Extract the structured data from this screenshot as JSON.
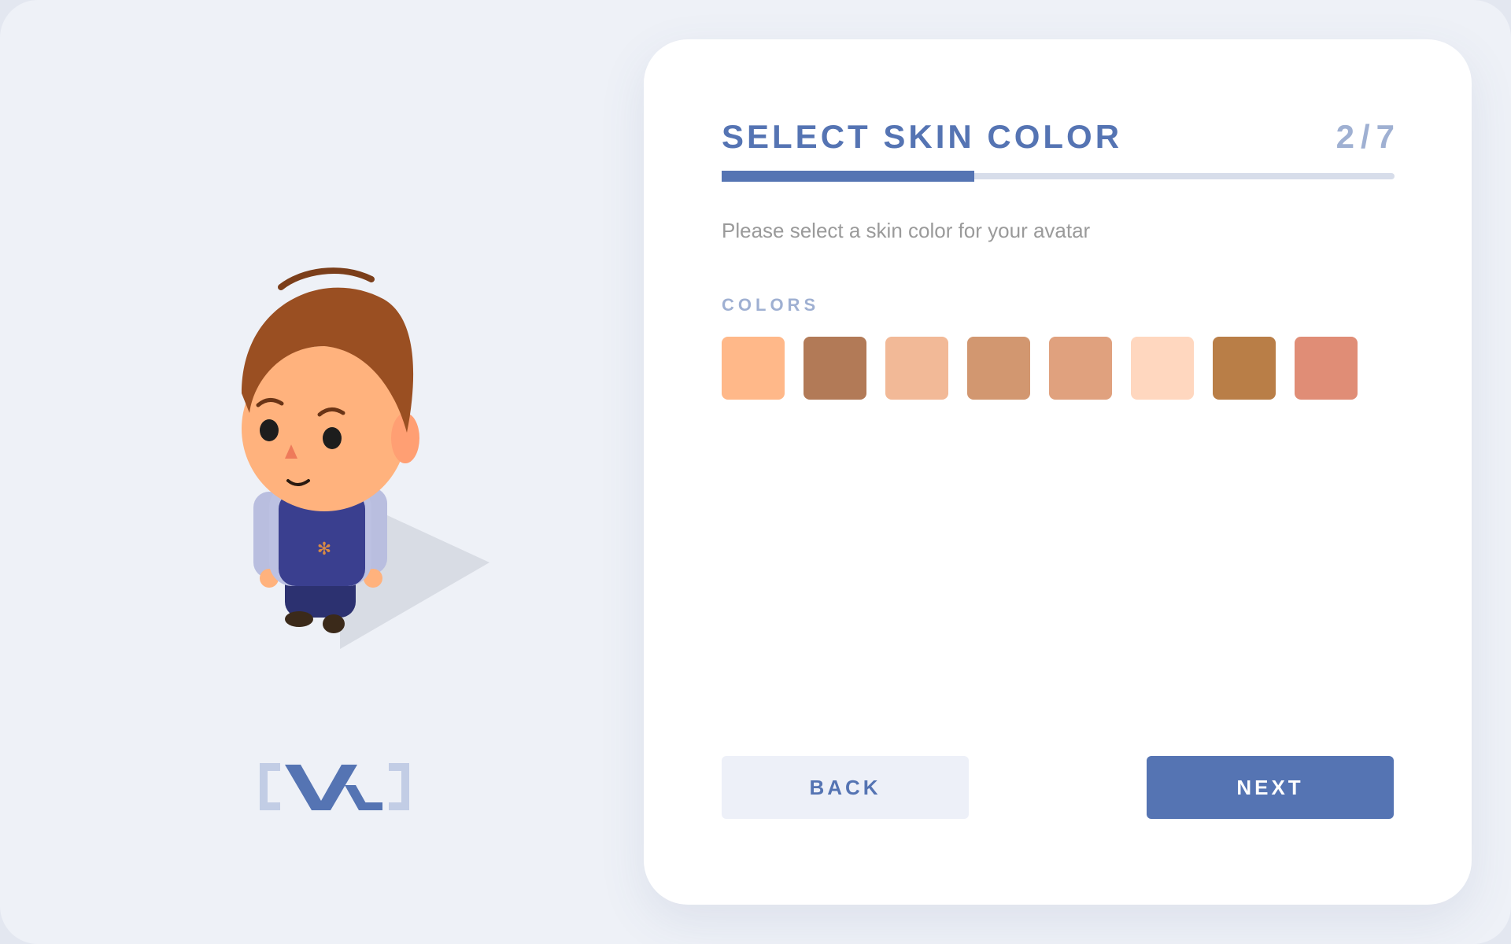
{
  "colors": {
    "accent": "#5574b3",
    "track": "#d7ddea",
    "muted": "#9fb0d2"
  },
  "header": {
    "title": "SELECT SKIN COLOR",
    "step": "2/7",
    "progress": 0.375
  },
  "main": {
    "subtitle": "Please select a skin color for your avatar",
    "section_label": "COLORS",
    "swatches": [
      "#ffb889",
      "#b27a57",
      "#f2b997",
      "#d29770",
      "#e0a17e",
      "#ffd7bf",
      "#b97e47",
      "#e08d76"
    ]
  },
  "footer": {
    "back_label": "BACK",
    "next_label": "NEXT"
  },
  "icons": {
    "avatar": "avatar-illustration",
    "logo": "brand-logo"
  }
}
